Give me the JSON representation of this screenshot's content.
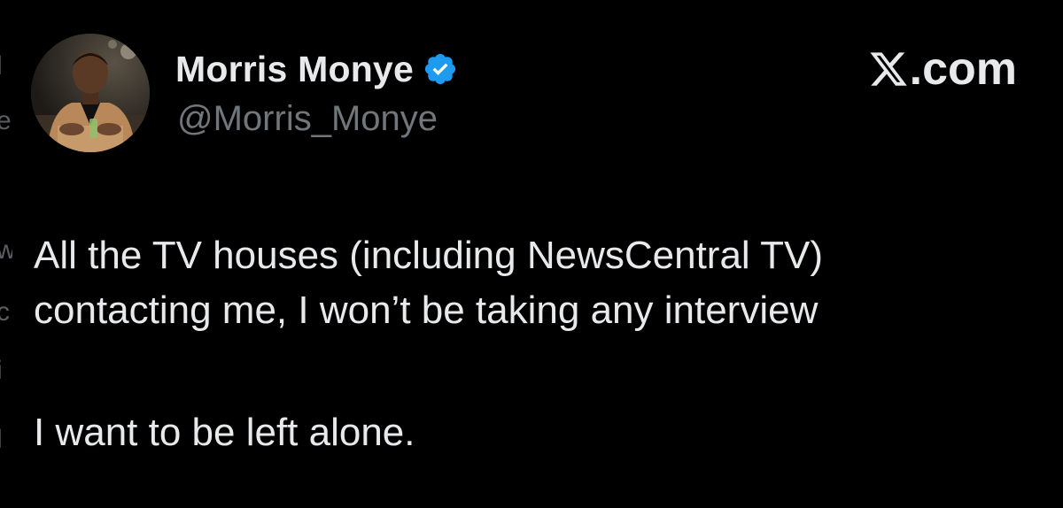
{
  "author": {
    "display_name": "Morris Monye",
    "handle": "@Morris_Monye",
    "verified": true,
    "verified_color": "#1d9bf0"
  },
  "brand": {
    "logo_icon": "x-logo-icon",
    "suffix": ".com"
  },
  "tweet": {
    "lines": [
      "All the TV houses (including NewsCentral TV)",
      "contacting me, I won’t be taking any interview",
      "I want to be left alone."
    ]
  },
  "colors": {
    "background": "#000000",
    "text_primary": "#e7e9ea",
    "text_secondary": "#71767b"
  }
}
